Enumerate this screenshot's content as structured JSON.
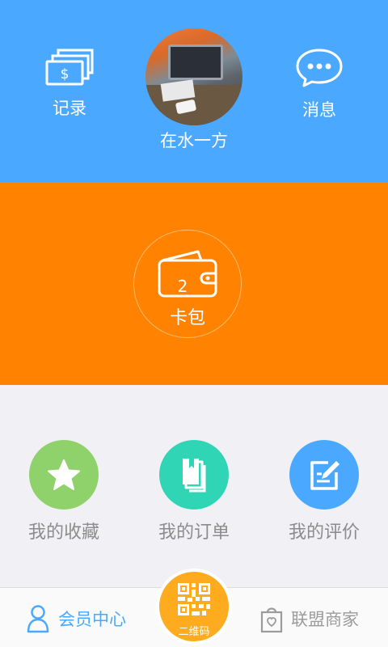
{
  "header": {
    "record_label": "记录",
    "record_icon": "cash-stack-icon",
    "messages_label": "消息",
    "messages_icon": "chat-bubble-icon",
    "user_name": "在水一方",
    "color": "#4aa9ff"
  },
  "wallet": {
    "count": "2",
    "label": "卡包",
    "icon": "wallet-icon",
    "color": "#ff8200"
  },
  "actions": [
    {
      "label": "我的收藏",
      "icon": "star-icon",
      "color": "#8fd16b"
    },
    {
      "label": "我的订单",
      "icon": "book-icon",
      "color": "#2fd5b5"
    },
    {
      "label": "我的评价",
      "icon": "edit-icon",
      "color": "#4aa9ff"
    }
  ],
  "bottom_bar": {
    "member_label": "会员中心",
    "member_icon": "person-icon",
    "qr_label": "二维码",
    "qr_icon": "qr-code-icon",
    "merchants_label": "联盟商家",
    "merchants_icon": "shopping-bag-icon"
  }
}
